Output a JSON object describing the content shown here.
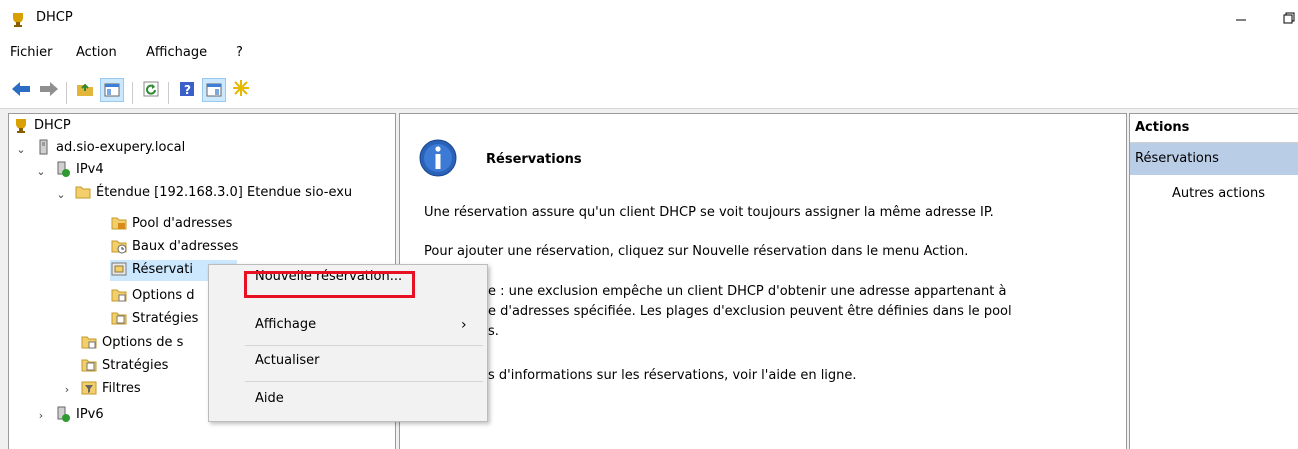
{
  "window": {
    "title": "DHCP"
  },
  "menubar": [
    "Fichier",
    "Action",
    "Affichage",
    "?"
  ],
  "tree": {
    "root": "DHCP",
    "server": "ad.sio-exupery.local",
    "ipv4": "IPv4",
    "scope": "Étendue [192.168.3.0] Etendue sio-exu",
    "pool": "Pool d'adresses",
    "leases": "Baux d'adresses",
    "reservations": "Réservati",
    "scope_options": "Options d",
    "scope_policies": "Stratégies",
    "server_options": "Options de s",
    "policies": "Stratégies",
    "filters": "Filtres",
    "ipv6": "IPv6"
  },
  "context_menu": {
    "new_reservation": "Nouvelle réservation...",
    "view": "Affichage",
    "refresh": "Actualiser",
    "help": "Aide"
  },
  "content": {
    "title": "Réservations",
    "p1": "Une réservation assure qu'un client DHCP se voit toujours assigner la même adresse IP.",
    "p2": "Pour ajouter une réservation, cliquez sur Nouvelle réservation dans le menu Action.",
    "p3a": "e : une exclusion empêche un client DHCP d'obtenir une adresse appartenant à",
    "p3b": "e d'adresses spécifiée. Les plages d'exclusion peuvent être définies dans le pool",
    "p3c": "s.",
    "p4": "s d'informations sur les réservations, voir l'aide en ligne."
  },
  "actions": {
    "header": "Actions",
    "section": "Réservations",
    "more": "Autres actions"
  },
  "colors": {
    "selection_blue": "#cce8ff",
    "actions_section": "#b9cde6",
    "highlight_red": "#e81123",
    "info_blue": "#2a62b8"
  }
}
